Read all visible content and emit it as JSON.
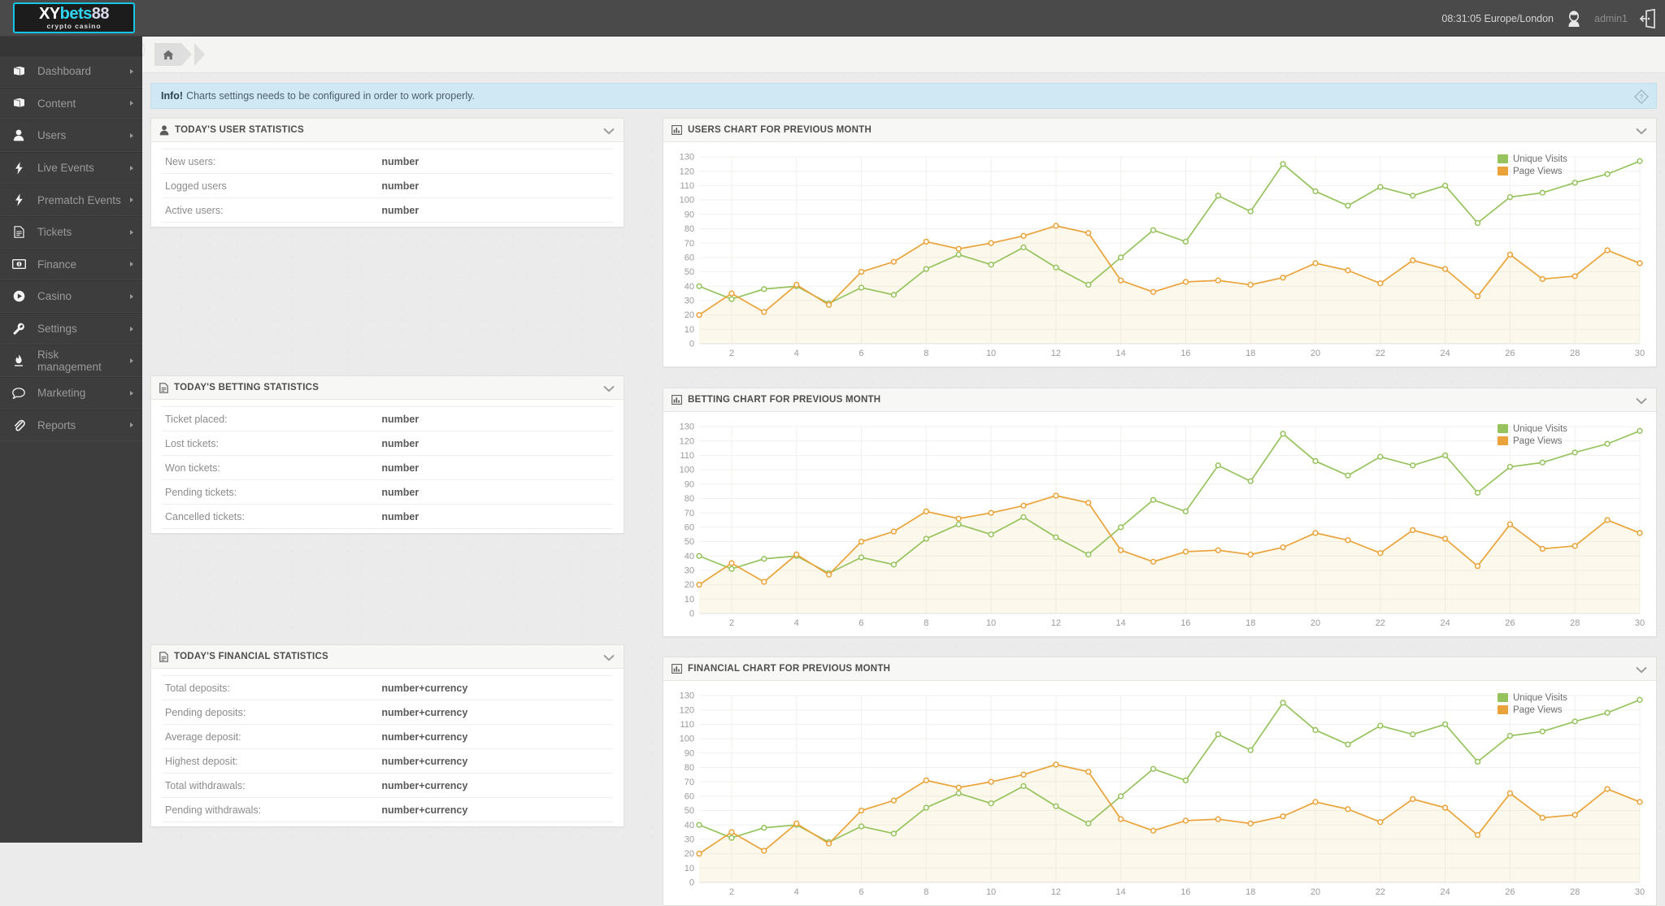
{
  "header": {
    "logo_main_xy": "XY",
    "logo_main_bets": "bets",
    "logo_main_88": "88",
    "logo_sub": "crypto casino",
    "clock": "08:31:05 Europe/London",
    "username": "admin1",
    "avatar_icon": "user-avatar-icon",
    "logout_icon": "logout-icon"
  },
  "sidebar": {
    "items": [
      {
        "label": "Dashboard",
        "icon": "book-icon"
      },
      {
        "label": "Content",
        "icon": "book-icon"
      },
      {
        "label": "Users",
        "icon": "user-icon"
      },
      {
        "label": "Live Events",
        "icon": "bolt-icon"
      },
      {
        "label": "Prematch Events",
        "icon": "bolt-icon"
      },
      {
        "label": "Tickets",
        "icon": "document-icon"
      },
      {
        "label": "Finance",
        "icon": "money-icon"
      },
      {
        "label": "Casino",
        "icon": "play-circle-icon"
      },
      {
        "label": "Settings",
        "icon": "wrench-icon"
      },
      {
        "label": "Risk management",
        "icon": "flame-icon"
      },
      {
        "label": "Marketing",
        "icon": "comment-icon"
      },
      {
        "label": "Reports",
        "icon": "paperclip-icon"
      }
    ]
  },
  "breadcrumb": {
    "home_icon": "home-icon",
    "collapse_icon": "chevron-left-icon"
  },
  "info_bar": {
    "strong": "Info!",
    "text": "Charts settings needs to be configured in order to work properly.",
    "help_icon": "question-mark-icon"
  },
  "panels": {
    "user_stats": {
      "title": "TODAY's USER STATISTICS",
      "icon": "user-stats-icon",
      "collapse_icon": "chevron-down-icon",
      "rows": [
        {
          "label": "New users:",
          "value": "number"
        },
        {
          "label": "Logged users",
          "value": "number"
        },
        {
          "label": "Active users:",
          "value": "number"
        }
      ]
    },
    "betting_stats": {
      "title": "TODAY's BETTING STATISTICS",
      "icon": "document-icon",
      "collapse_icon": "chevron-down-icon",
      "rows": [
        {
          "label": "Ticket placed:",
          "value": "number"
        },
        {
          "label": "Lost tickets:",
          "value": "number"
        },
        {
          "label": "Won tickets:",
          "value": "number"
        },
        {
          "label": "Pending tickets:",
          "value": "number"
        },
        {
          "label": "Cancelled tickets:",
          "value": "number"
        }
      ]
    },
    "financial_stats": {
      "title": "TODAY's FINANCIAL STATISTICS",
      "icon": "document-icon",
      "collapse_icon": "chevron-down-icon",
      "rows": [
        {
          "label": "Total deposits:",
          "value": "number+currency"
        },
        {
          "label": "Pending deposits:",
          "value": "number+currency"
        },
        {
          "label": "Average deposit:",
          "value": "number+currency"
        },
        {
          "label": "Highest deposit:",
          "value": "number+currency"
        },
        {
          "label": "Total withdrawals:",
          "value": "number+currency"
        },
        {
          "label": "Pending withdrawals:",
          "value": "number+currency"
        }
      ]
    },
    "users_chart": {
      "title": "USERS CHART FOR PREVIOUS MONTH",
      "icon": "bar-chart-icon",
      "collapse_icon": "chevron-down-icon"
    },
    "betting_chart": {
      "title": "BETTING CHART FOR PREVIOUS MONTH",
      "icon": "bar-chart-icon",
      "collapse_icon": "chevron-down-icon"
    },
    "financial_chart": {
      "title": "FINANCIAL CHART FOR PREVIOUS MONTH",
      "icon": "bar-chart-icon",
      "collapse_icon": "chevron-down-icon"
    }
  },
  "colors": {
    "unique_visits": "#96c35e",
    "page_views": "#e9a33a",
    "topbar": "#4a4a4a",
    "sidebar": "#3d3d3d",
    "info_bg": "#cfe8f3"
  },
  "chart_data": {
    "type": "line",
    "title": "USERS CHART FOR PREVIOUS MONTH",
    "xlabel": "",
    "ylabel": "",
    "xlim": [
      1,
      30
    ],
    "ylim": [
      0,
      130
    ],
    "yticks": [
      0,
      10,
      20,
      30,
      40,
      50,
      60,
      70,
      80,
      90,
      100,
      110,
      120,
      130
    ],
    "xticks": [
      2,
      4,
      6,
      8,
      10,
      12,
      14,
      16,
      18,
      20,
      22,
      24,
      26,
      28,
      30
    ],
    "grid": true,
    "legend_position": "top-right",
    "x": [
      1,
      2,
      3,
      4,
      5,
      6,
      7,
      8,
      9,
      10,
      11,
      12,
      13,
      14,
      15,
      16,
      17,
      18,
      19,
      20,
      21,
      22,
      23,
      24,
      25,
      26,
      27,
      28,
      29,
      30
    ],
    "series": [
      {
        "name": "Unique Visits",
        "color": "#96c35e",
        "values": [
          40,
          31,
          38,
          40,
          28,
          39,
          34,
          52,
          62,
          55,
          67,
          53,
          41,
          60,
          79,
          71,
          103,
          92,
          125,
          106,
          96,
          109,
          103,
          110,
          84,
          102,
          105,
          112,
          118,
          127
        ]
      },
      {
        "name": "Page Views",
        "color": "#e9a33a",
        "values": [
          20,
          35,
          22,
          41,
          27,
          50,
          57,
          71,
          66,
          70,
          75,
          82,
          77,
          44,
          36,
          43,
          44,
          41,
          46,
          56,
          51,
          42,
          58,
          52,
          33,
          62,
          45,
          47,
          65,
          56
        ]
      }
    ]
  }
}
